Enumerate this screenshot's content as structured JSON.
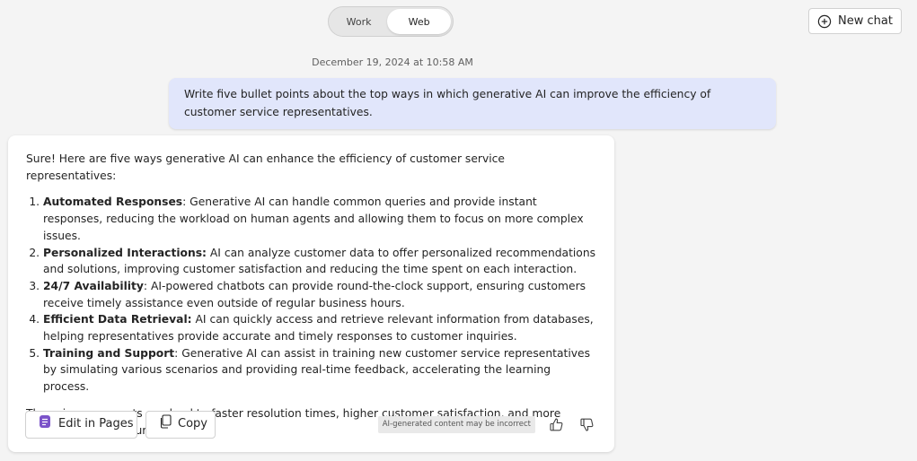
{
  "mode_toggle": {
    "options": [
      "Work",
      "Web"
    ],
    "selected": "Web"
  },
  "header": {
    "new_chat_label": "New chat"
  },
  "conversation": {
    "timestamp": "December 19, 2024 at 10:58 AM",
    "user_message": "Write five  bullet  points about the top ways in which generative AI can improve the efficiency of customer service representatives.",
    "response": {
      "intro": "Sure! Here are five ways generative AI can enhance the efficiency of customer service representatives:",
      "items": [
        {
          "title": "Automated Responses",
          "text": ": Generative AI can handle common queries and provide instant responses, reducing the workload on human agents and allowing them to focus on more complex issues."
        },
        {
          "title": "Personalized Interactions:",
          "text": " AI can analyze customer data to offer personalized recommendations and solutions, improving customer satisfaction and reducing the time spent on each interaction."
        },
        {
          "title": "24/7 Availability",
          "text": ": AI-powered chatbots can provide round-the-clock support, ensuring customers receive timely assistance even outside of regular business hours."
        },
        {
          "title": "Efficient Data Retrieval:",
          "text": " AI can quickly access and retrieve relevant information from databases, helping representatives provide accurate and timely responses to customer inquiries."
        },
        {
          "title": "Training and Support",
          "text": ": Generative AI can assist in training new customer service representatives by simulating various scenarios and providing real-time feedback, accelerating the learning process."
        }
      ],
      "outro": "These improvements can lead to faster resolution times, higher customer satisfaction, and more efficient use of resources."
    },
    "actions": {
      "edit_in_pages_label": "Edit in Pages",
      "copy_label": "Copy",
      "disclaimer": "AI-generated content may be incorrect"
    }
  },
  "icons": {
    "new_chat": "plus-circle-icon",
    "pages": "pages-icon",
    "copy": "copy-icon",
    "like": "thumbs-up-icon",
    "dislike": "thumbs-down-icon"
  },
  "colors": {
    "page_background": "#f4f4f4",
    "user_bubble": "#e1e6fb",
    "pages_icon": "#7b53c9",
    "card_background": "#ffffff"
  }
}
